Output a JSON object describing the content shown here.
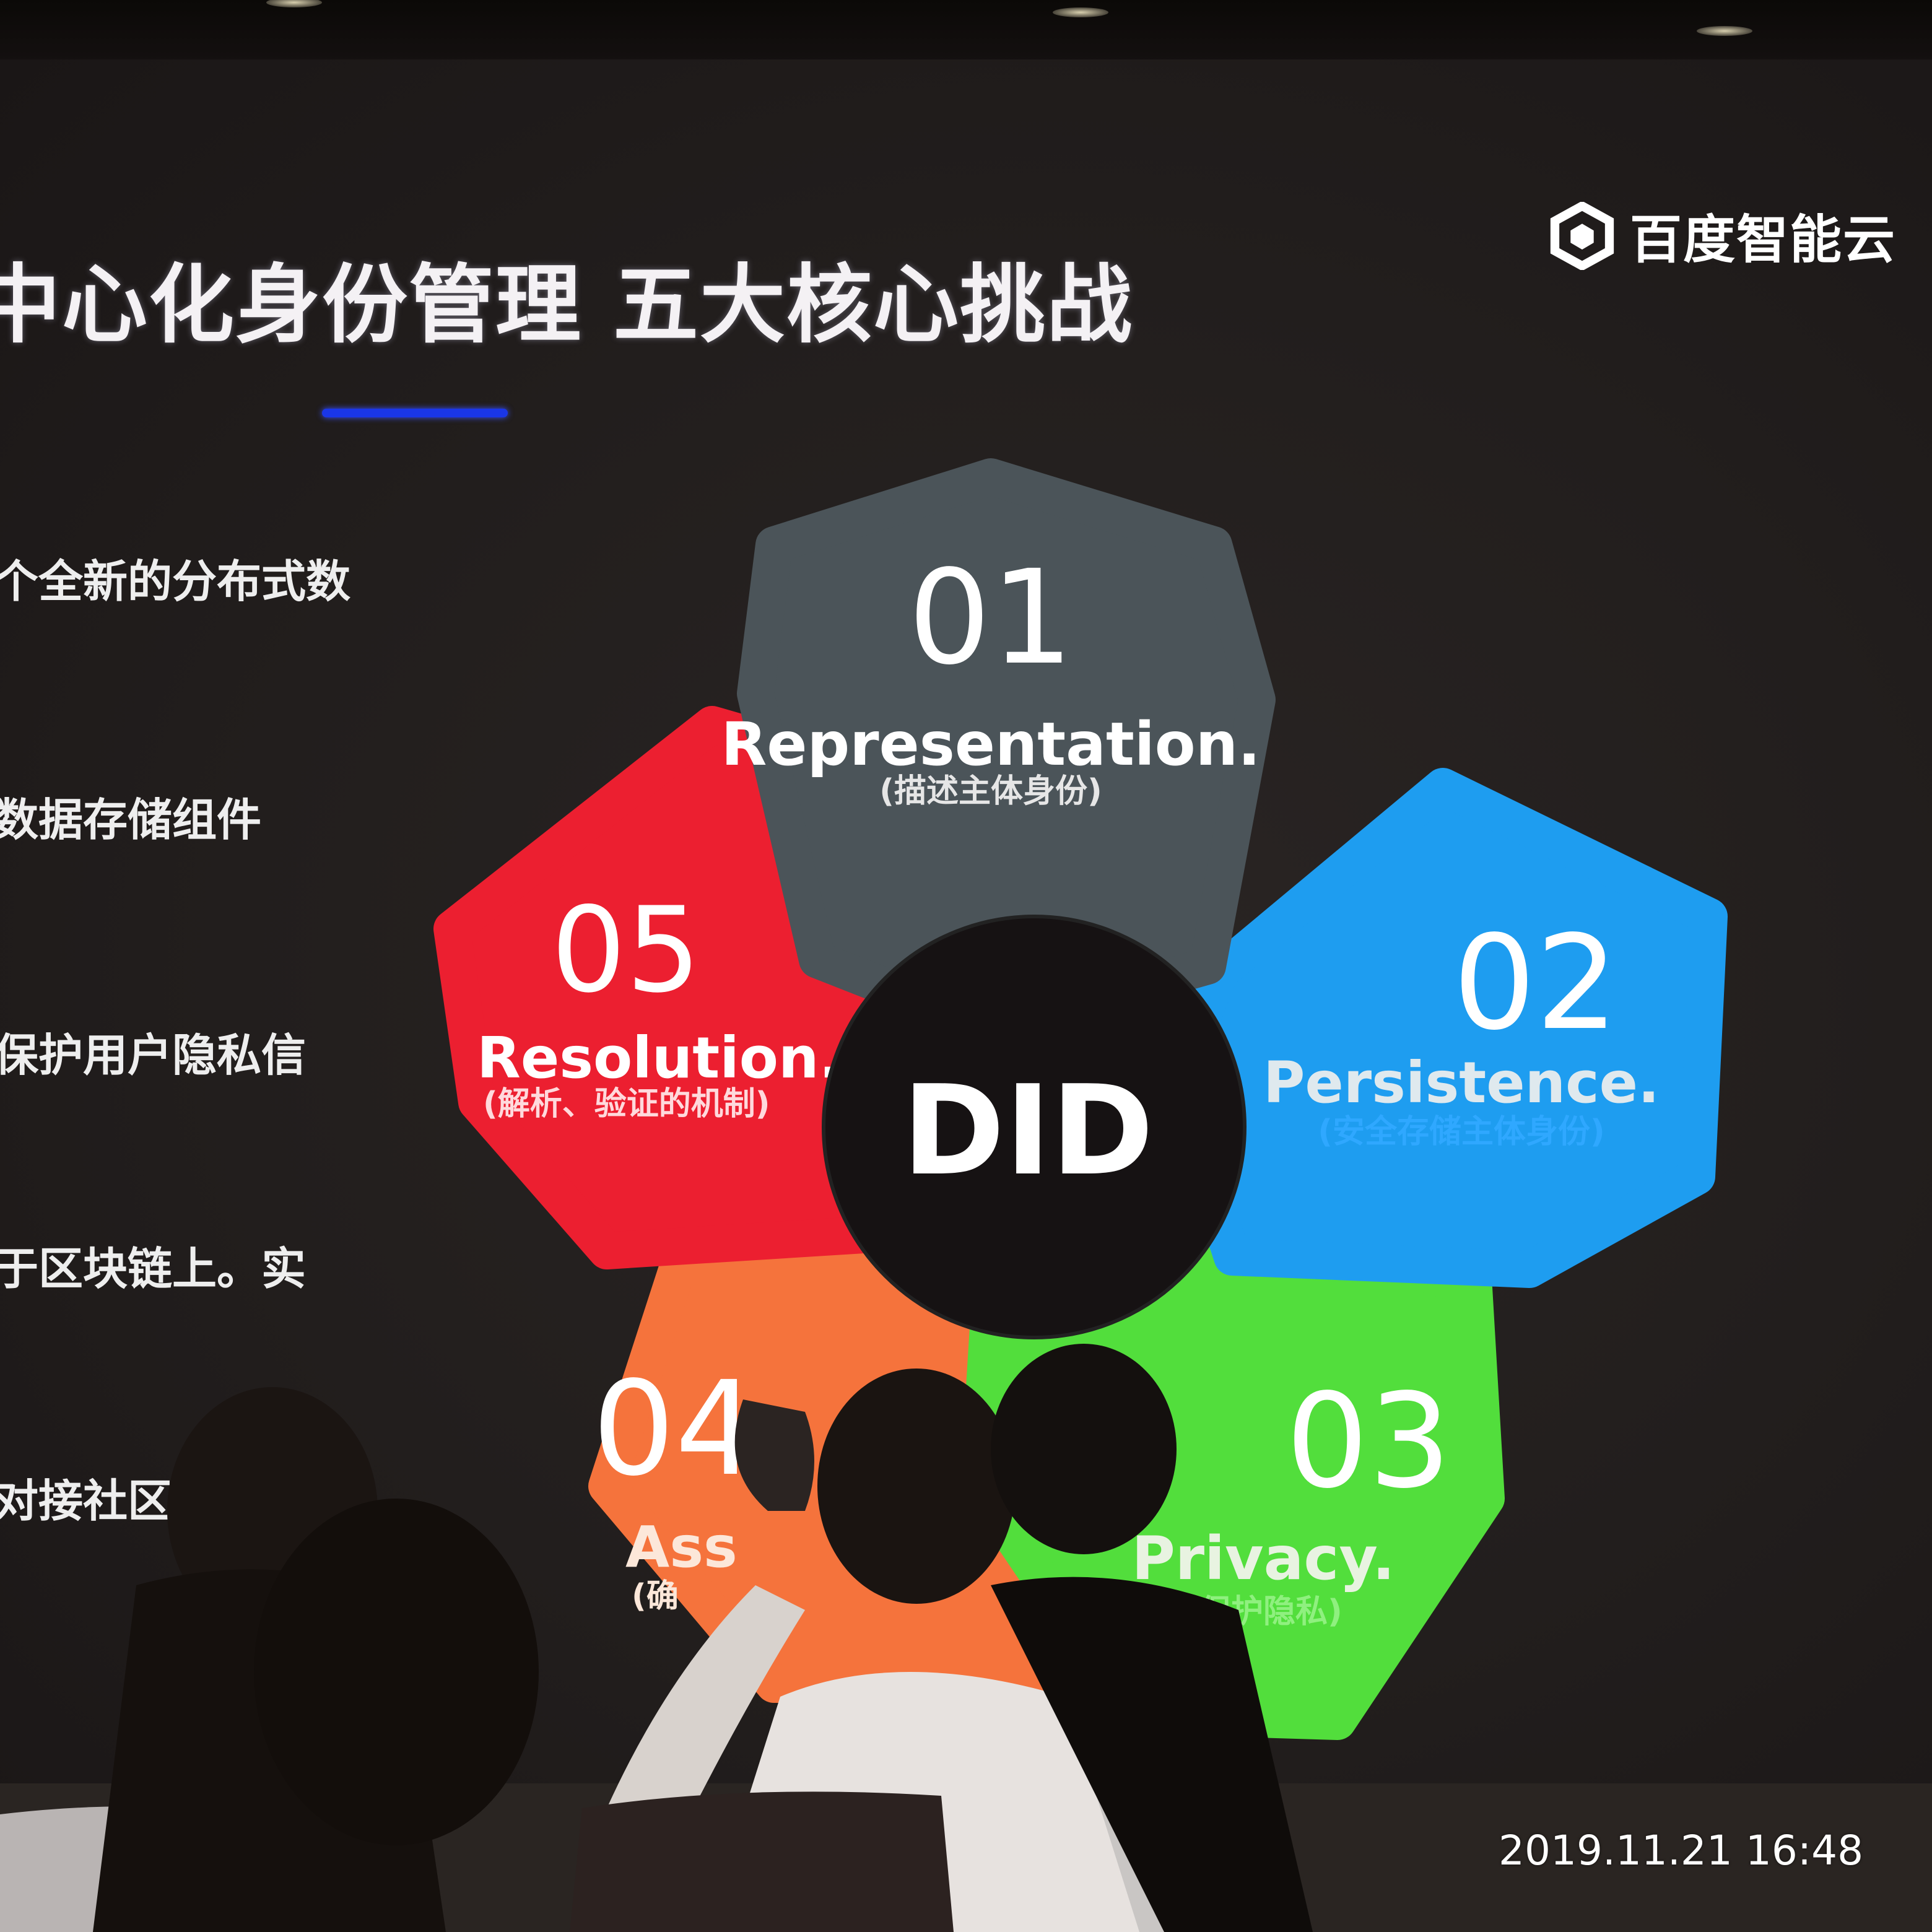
{
  "slide": {
    "title": "中心化身份管理  五大核心挑战",
    "brand_name": "百度智能云",
    "bullets": [
      "个全新的分布式数",
      "数据存储组件",
      "保护用户隐私信",
      "于区块链上。实",
      "对接社区。"
    ],
    "center_label": "DID",
    "petals": [
      {
        "number": "01",
        "title": "Representation.",
        "subtitle": "(描述主体身份)",
        "color": "#4b5459"
      },
      {
        "number": "02",
        "title": "Persistence.",
        "subtitle": "(安全存储主体身份)",
        "color": "#1e9df0"
      },
      {
        "number": "03",
        "title": "Privacy.",
        "subtitle": "(保护隐私)",
        "color": "#52de3c"
      },
      {
        "number": "04",
        "title": "Ass",
        "subtitle": "(确",
        "color": "#f5733c"
      },
      {
        "number": "05",
        "title": "Resolution.",
        "subtitle": "(解析、验证的机制)",
        "color": "#ec1f30"
      }
    ]
  },
  "photo": {
    "timestamp": "2019.11.21 16:48"
  }
}
